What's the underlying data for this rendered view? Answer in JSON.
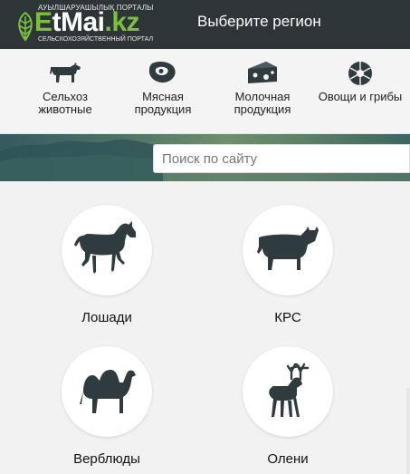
{
  "header": {
    "logo": {
      "tagline_top": "АУЫЛШАРУАШЫЛЫҚ ПОРТАЛЫ",
      "brand_prefix": "E",
      "brand_main": "tMai",
      "brand_suffix": ".kz",
      "tagline_bottom": "СЕЛЬСКОХОЗЯЙСТВЕННЫЙ ПОРТАЛ"
    },
    "region_label": "Выберите регион"
  },
  "categories": [
    {
      "icon": "cow-icon",
      "line1": "Сельхоз",
      "line2": "животные"
    },
    {
      "icon": "meat-icon",
      "line1": "Мясная",
      "line2": "продукция"
    },
    {
      "icon": "cheese-icon",
      "line1": "Молочная",
      "line2": "продукция"
    },
    {
      "icon": "vegetables-icon",
      "line1": "Овощи и грибы",
      "line2": ""
    }
  ],
  "search": {
    "placeholder": "Поиск по сайту"
  },
  "animals": [
    {
      "icon": "horse-icon",
      "name": "Лошади"
    },
    {
      "icon": "cattle-icon",
      "name": "КРС"
    },
    {
      "icon": "camel-icon",
      "name": "Верблюды"
    },
    {
      "icon": "deer-icon",
      "name": "Олени"
    }
  ],
  "colors": {
    "header_bg": "#2d3537",
    "brand_green": "#7cbf3f",
    "icon_dark": "#2f3b3f",
    "page_bg": "#f2f2f2"
  }
}
